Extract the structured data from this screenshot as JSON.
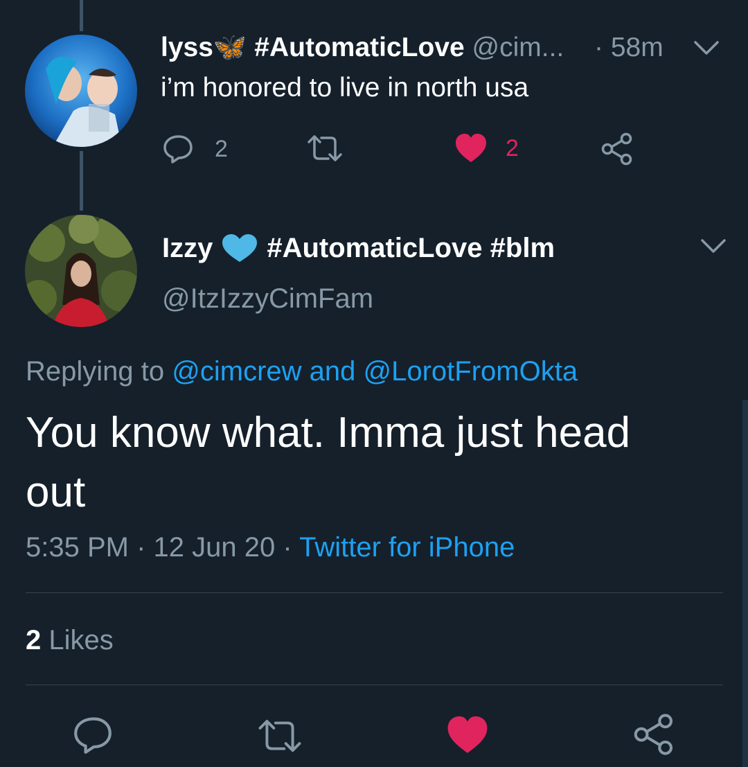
{
  "parent_tweet": {
    "display_name": "lyss🦋 #AutomaticLove",
    "handle": "@cim...",
    "time": "· 58m",
    "text": "i’m honored to live in north usa",
    "reply_count": "2",
    "like_count": "2"
  },
  "main_tweet": {
    "display_name": "Izzy",
    "hashtags": "#AutomaticLove #blm",
    "handle": "@ItzIzzyCimFam",
    "replying_prefix": "Replying to",
    "reply_user_1": "@cimcrew",
    "reply_and": "and",
    "reply_user_2": "@LorotFromOkta",
    "text_line1": "You know what. Imma just head",
    "text_line2": "out",
    "time": "5:35 PM",
    "date": "12 Jun 20",
    "source": "Twitter for iPhone",
    "sep": "·",
    "likes_count": "2",
    "likes_label": "Likes"
  },
  "colors": {
    "background": "#15202b",
    "accent": "#1da1f2",
    "muted": "#8899a6",
    "like": "#e0245e"
  },
  "icons": {
    "reply": "speech-bubble-icon",
    "retweet": "retweet-icon",
    "like": "heart-icon",
    "share": "share-icon",
    "more": "chevron-down-icon",
    "badge": "blue-heart-emoji"
  }
}
